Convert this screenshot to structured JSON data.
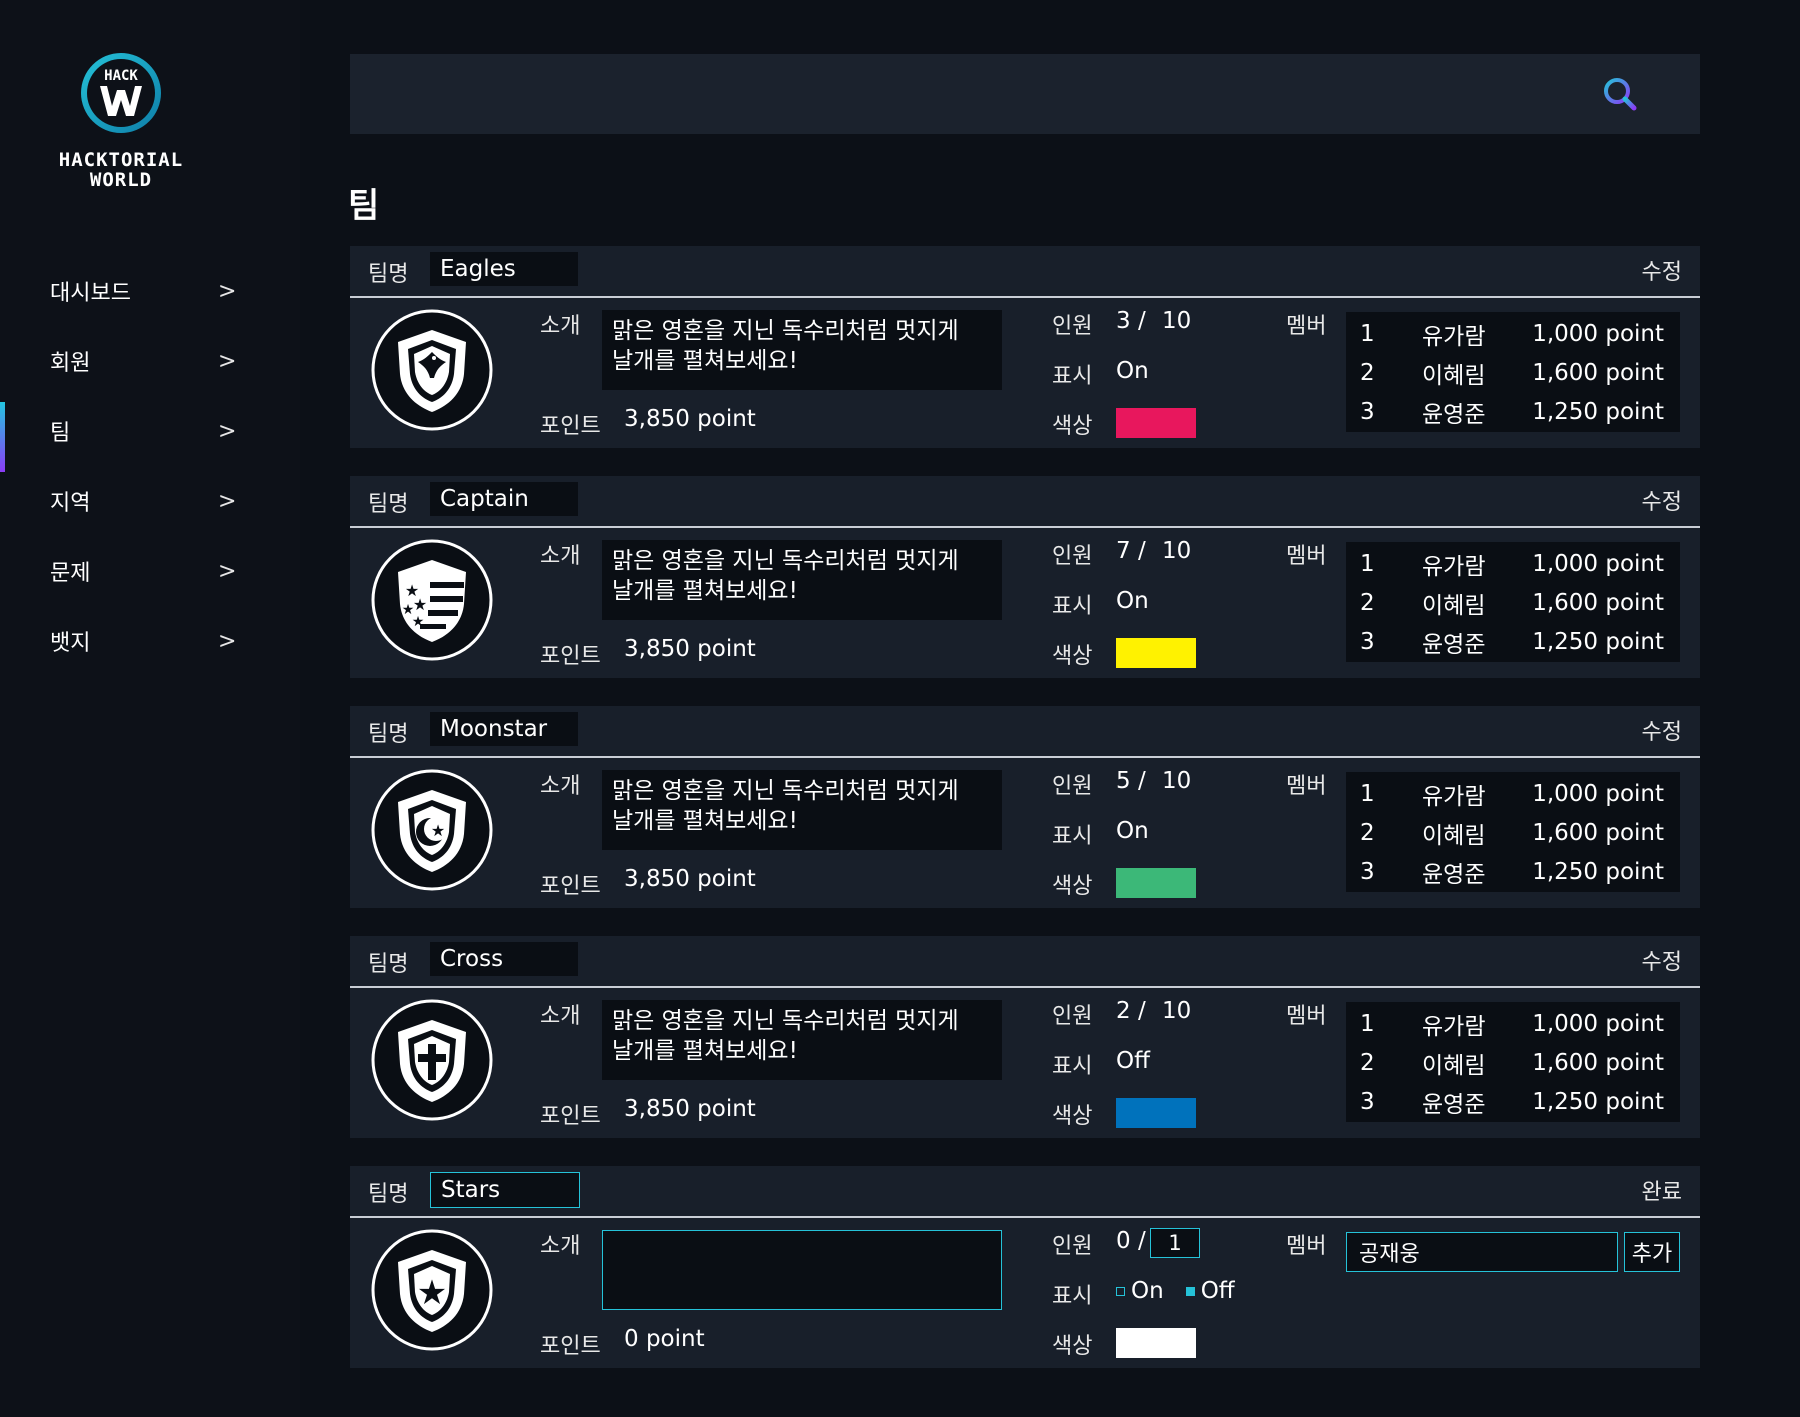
{
  "brand": {
    "logo_top": "HACK",
    "logo_name_line1": "HACKTORIAL",
    "logo_name_line2": "WORLD",
    "accent": "#25c2d8",
    "accent2": "#8b3cf5"
  },
  "sidebar": {
    "items": [
      {
        "label": "대시보드",
        "chevron": ">"
      },
      {
        "label": "회원",
        "chevron": ">"
      },
      {
        "label": "팀",
        "chevron": ">",
        "active": true
      },
      {
        "label": "지역",
        "chevron": ">"
      },
      {
        "label": "문제",
        "chevron": ">"
      },
      {
        "label": "뱃지",
        "chevron": ">"
      }
    ]
  },
  "search": {
    "value": "",
    "icon": "search-icon"
  },
  "page": {
    "title": "팀"
  },
  "labels": {
    "team_name": "팀명",
    "intro": "소개",
    "points": "포인트",
    "count": "인원",
    "display": "표시",
    "color": "색상",
    "members": "멤버",
    "edit": "수정",
    "done": "완료",
    "add": "추가"
  },
  "teams": [
    {
      "name": "Eagles",
      "emblem": "eagle-shield-icon",
      "intro_line1": "맑은 영혼을 지닌 독수리처럼 멋지게",
      "intro_line2": "날개를 펼쳐보세요!",
      "points": "3,850 point",
      "count": "3 /",
      "max": "10",
      "display": "On",
      "color": "#e8175d",
      "members": [
        {
          "n": "1",
          "name": "유가람",
          "points": "1,000 point"
        },
        {
          "n": "2",
          "name": "이혜림",
          "points": "1,600 point"
        },
        {
          "n": "3",
          "name": "윤영준",
          "points": "1,250 point"
        }
      ]
    },
    {
      "name": "Captain",
      "emblem": "stars-stripes-shield-icon",
      "intro_line1": "맑은 영혼을 지닌 독수리처럼 멋지게",
      "intro_line2": "날개를 펼쳐보세요!",
      "points": "3,850 point",
      "count": "7 /",
      "max": "10",
      "display": "On",
      "color": "#fff200",
      "members": [
        {
          "n": "1",
          "name": "유가람",
          "points": "1,000 point"
        },
        {
          "n": "2",
          "name": "이혜림",
          "points": "1,600 point"
        },
        {
          "n": "3",
          "name": "윤영준",
          "points": "1,250 point"
        }
      ]
    },
    {
      "name": "Moonstar",
      "emblem": "moon-star-shield-icon",
      "intro_line1": "맑은 영혼을 지닌 독수리처럼 멋지게",
      "intro_line2": "날개를 펼쳐보세요!",
      "points": "3,850 point",
      "count": "5 /",
      "max": "10",
      "display": "On",
      "color": "#3cb878",
      "members": [
        {
          "n": "1",
          "name": "유가람",
          "points": "1,000 point"
        },
        {
          "n": "2",
          "name": "이혜림",
          "points": "1,600 point"
        },
        {
          "n": "3",
          "name": "윤영준",
          "points": "1,250 point"
        }
      ]
    },
    {
      "name": "Cross",
      "emblem": "cross-shield-icon",
      "intro_line1": "맑은 영혼을 지닌 독수리처럼 멋지게",
      "intro_line2": "날개를 펼쳐보세요!",
      "points": "3,850 point",
      "count": "2 /",
      "max": "10",
      "display": "Off",
      "color": "#0072bc",
      "members": [
        {
          "n": "1",
          "name": "유가람",
          "points": "1,000 point"
        },
        {
          "n": "2",
          "name": "이혜림",
          "points": "1,600 point"
        },
        {
          "n": "3",
          "name": "윤영준",
          "points": "1,250 point"
        }
      ]
    }
  ],
  "edit_team": {
    "name": "Stars",
    "emblem": "star-shield-icon",
    "intro": "",
    "points": "0 point",
    "count": "0 /",
    "max": "1",
    "display_on": "On",
    "display_off": "Off",
    "display_selected": "Off",
    "color": "#ffffff",
    "member_input": "공재웅"
  }
}
